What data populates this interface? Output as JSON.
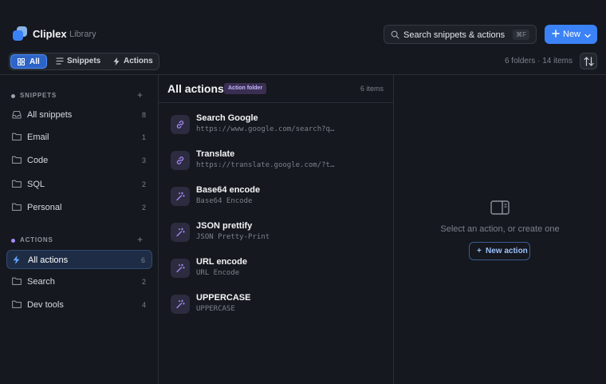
{
  "app": {
    "title": "Cliplex",
    "subtitle": "Library"
  },
  "search": {
    "placeholder": "Search snippets & actions",
    "shortcut": "⌘F"
  },
  "new_button": {
    "label": "New"
  },
  "filter_tabs": [
    {
      "label": "All",
      "active": true,
      "icon": "grid-icon"
    },
    {
      "label": "Snippets",
      "active": false,
      "icon": "lines-icon"
    },
    {
      "label": "Actions",
      "active": false,
      "icon": "bolt-icon"
    }
  ],
  "summary": {
    "counts": "6 folders · 14 items"
  },
  "sidebar": {
    "snippets": {
      "heading": "SNIPPETS",
      "dot_color": "#9ca3af",
      "add": "+",
      "items": [
        {
          "label": "All snippets",
          "count": "8",
          "icon": "inbox-icon"
        },
        {
          "label": "Email",
          "count": "1",
          "icon": "folder-icon"
        },
        {
          "label": "Code",
          "count": "3",
          "icon": "folder-icon"
        },
        {
          "label": "SQL",
          "count": "2",
          "icon": "folder-icon"
        },
        {
          "label": "Personal",
          "count": "2",
          "icon": "folder-icon"
        }
      ]
    },
    "actions": {
      "heading": "ACTIONS",
      "dot_color": "#a78bfa",
      "add": "+",
      "items": [
        {
          "label": "All actions",
          "count": "6",
          "icon": "bolt-icon",
          "active": true
        },
        {
          "label": "Search",
          "count": "2",
          "icon": "folder-icon"
        },
        {
          "label": "Dev tools",
          "count": "4",
          "icon": "folder-icon"
        }
      ]
    }
  },
  "list": {
    "title": "All actions",
    "badge": "Action folder",
    "count": "6 items",
    "items": [
      {
        "name": "Search Google",
        "detail": "https://www.google.com/search?q…",
        "icon": "link-icon"
      },
      {
        "name": "Translate",
        "detail": "https://translate.google.com/?t…",
        "icon": "link-icon"
      },
      {
        "name": "Base64 encode",
        "detail": "Base64 Encode",
        "icon": "wand-icon"
      },
      {
        "name": "JSON prettify",
        "detail": "JSON Pretty-Print",
        "icon": "wand-icon"
      },
      {
        "name": "URL encode",
        "detail": "URL Encode",
        "icon": "wand-icon"
      },
      {
        "name": "UPPERCASE",
        "detail": "UPPERCASE",
        "icon": "wand-icon"
      }
    ]
  },
  "detail": {
    "empty_text": "Select an action, or create one",
    "new_action_label": "New action",
    "plus": "+"
  },
  "colors": {
    "accent": "#3b82f6",
    "background": "#15181e",
    "badge_bg": "#3a2f52",
    "badge_text": "#c4b5fd"
  }
}
